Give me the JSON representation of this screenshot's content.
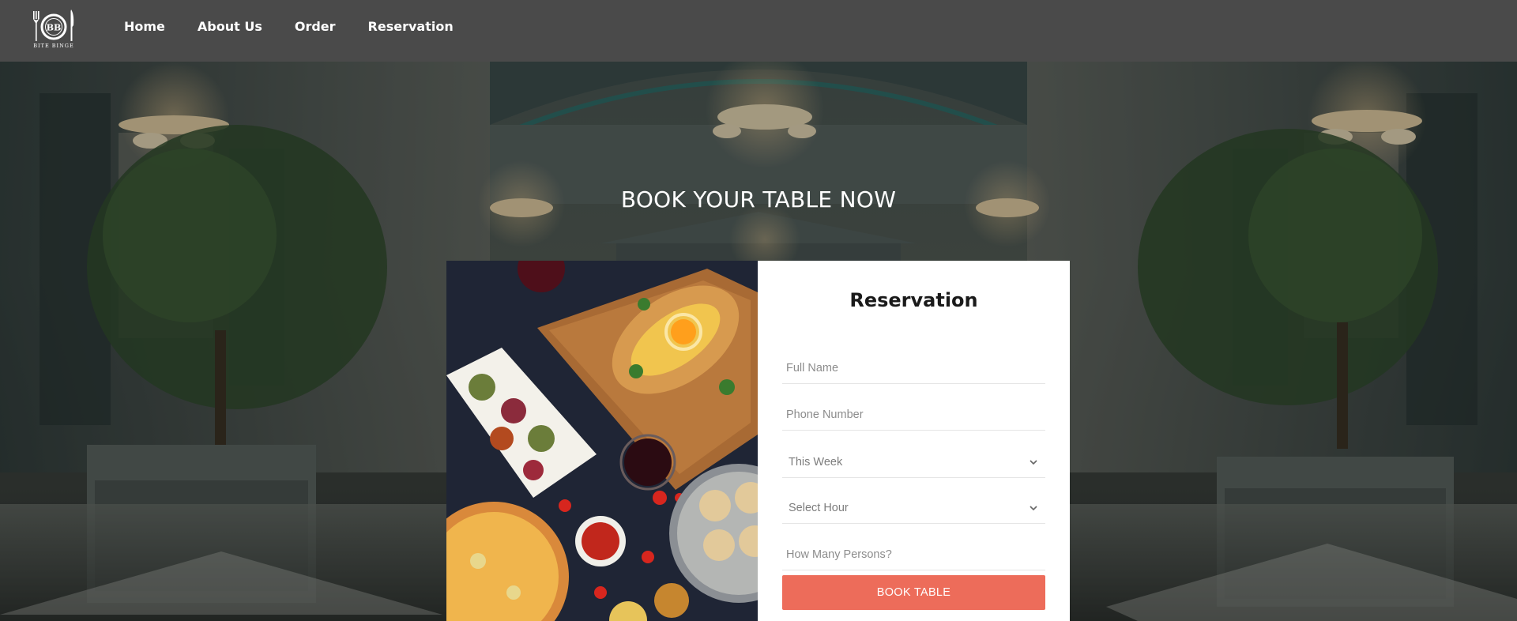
{
  "brand": {
    "logo_mark": "BB",
    "logo_text": "BITE BINGE"
  },
  "nav": {
    "items": [
      {
        "label": "Home"
      },
      {
        "label": "About Us"
      },
      {
        "label": "Order"
      },
      {
        "label": "Reservation"
      }
    ]
  },
  "hero": {
    "title": "BOOK YOUR TABLE NOW"
  },
  "reservation": {
    "title": "Reservation",
    "full_name_placeholder": "Full Name",
    "phone_placeholder": "Phone Number",
    "week_select_value": "This Week",
    "hour_select_value": "Select Hour",
    "persons_placeholder": "How Many Persons?",
    "submit_label": "BOOK TABLE"
  },
  "colors": {
    "header_bg": "#4a4a4a",
    "accent_button": "#ed6c5a",
    "text_on_dark": "#ffffff"
  },
  "icons": [
    "fork-knife-logo-icon",
    "chevron-down-icon"
  ]
}
